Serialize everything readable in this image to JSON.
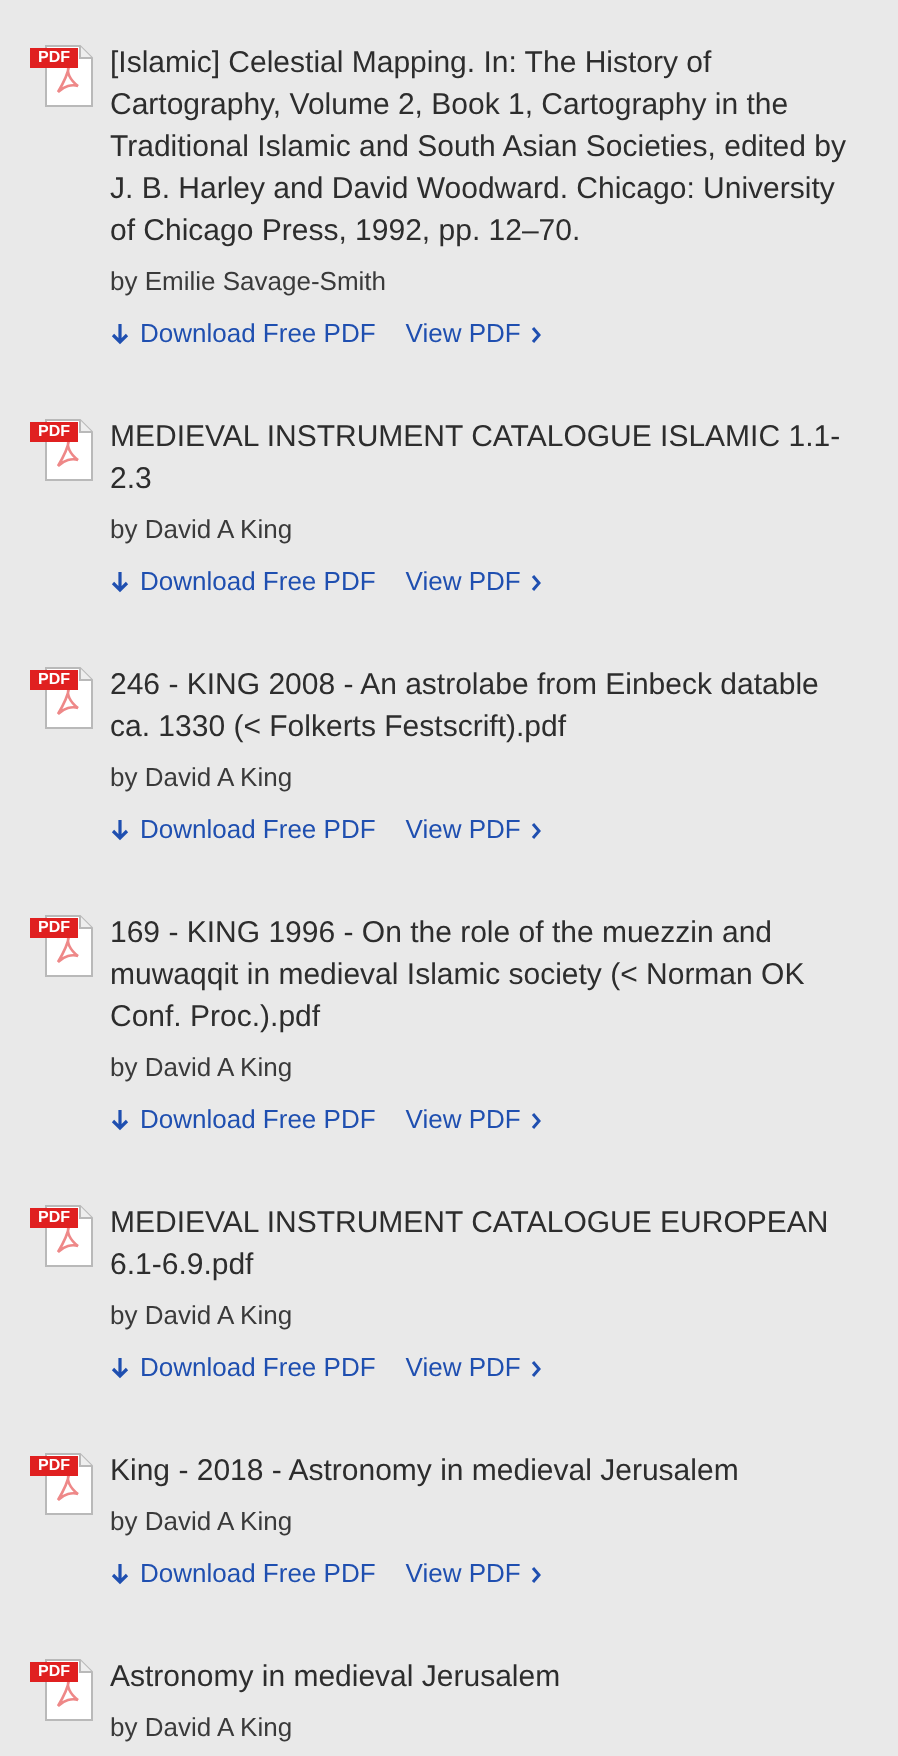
{
  "results": [
    {
      "icon_text": "PDF",
      "title": "[Islamic] Celestial Mapping. In: The History of Cartography, Volume 2, Book 1, Cartography in the Traditional Islamic and South Asian Societies, edited by J. B. Harley and David Woodward. Chicago: University of Chicago Press, 1992, pp. 12–70.",
      "author": "by Emilie Savage-Smith",
      "actions": [
        {
          "kind": "download",
          "label": "Download Free PDF"
        },
        {
          "kind": "view",
          "label": "View PDF"
        }
      ]
    },
    {
      "icon_text": "PDF",
      "title": "MEDIEVAL INSTRUMENT CATALOGUE ISLAMIC 1.1-2.3",
      "author": "by David A King",
      "actions": [
        {
          "kind": "download",
          "label": "Download Free PDF"
        },
        {
          "kind": "view",
          "label": "View PDF"
        }
      ]
    },
    {
      "icon_text": "PDF",
      "title": "246 - KING 2008 - An astrolabe from Einbeck datable ca. 1330 (< Folkerts Festscrift).pdf",
      "author": "by David A King",
      "actions": [
        {
          "kind": "download",
          "label": "Download Free PDF"
        },
        {
          "kind": "view",
          "label": "View PDF"
        }
      ]
    },
    {
      "icon_text": "PDF",
      "title": "169 - KING 1996 - On the role of the muezzin and muwaqqit in medieval Islamic society (< Norman OK Conf. Proc.).pdf",
      "author": "by David A King",
      "actions": [
        {
          "kind": "download",
          "label": "Download Free PDF"
        },
        {
          "kind": "view",
          "label": "View PDF"
        }
      ]
    },
    {
      "icon_text": "PDF",
      "title": "MEDIEVAL INSTRUMENT CATALOGUE EUROPEAN 6.1-6.9.pdf",
      "author": "by David A King",
      "actions": [
        {
          "kind": "download",
          "label": "Download Free PDF"
        },
        {
          "kind": "view",
          "label": "View PDF"
        }
      ]
    },
    {
      "icon_text": "PDF",
      "title": "King - 2018 - Astronomy in medieval Jerusalem",
      "author": "by David A King",
      "actions": [
        {
          "kind": "download",
          "label": "Download Free PDF"
        },
        {
          "kind": "view",
          "label": "View PDF"
        }
      ]
    },
    {
      "icon_text": "PDF",
      "title": "Astronomy in medieval Jerusalem",
      "author": "by David A King"
    }
  ]
}
